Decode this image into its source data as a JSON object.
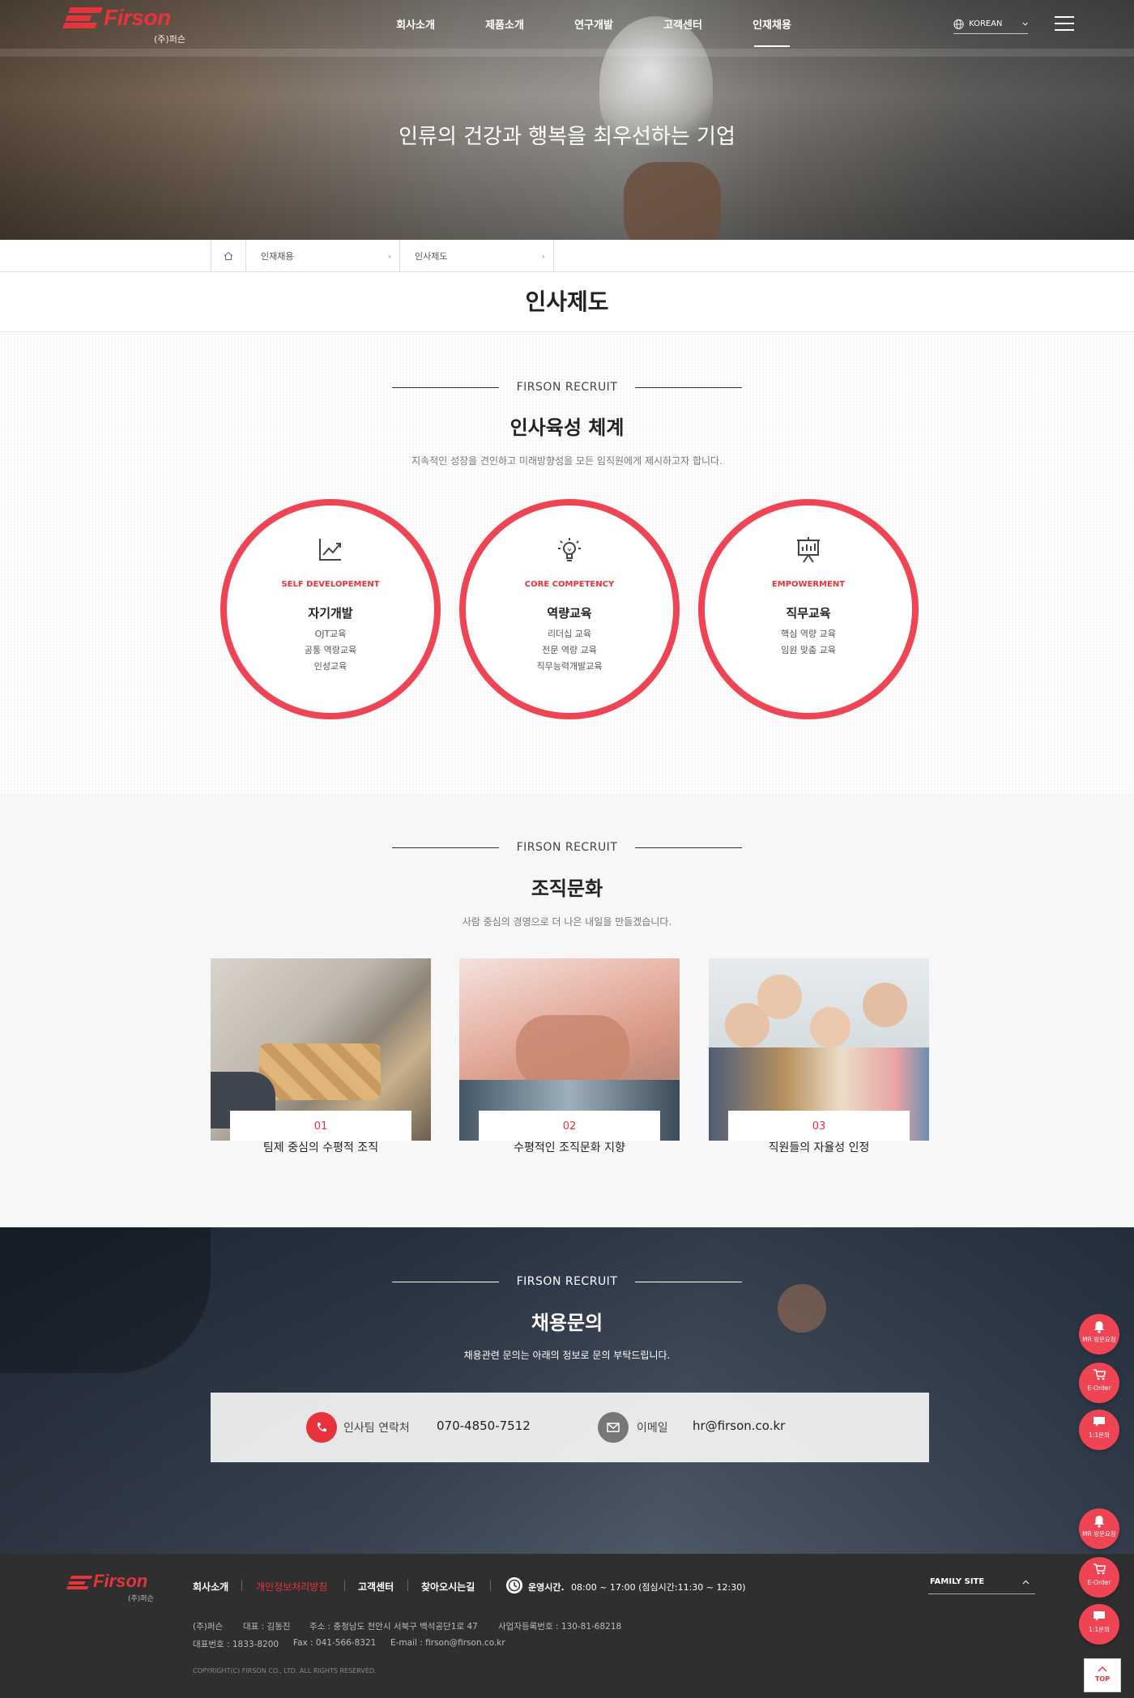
{
  "header": {
    "logo_text": "Firson",
    "logo_sub": "(주)퍼슨",
    "nav": [
      "회사소개",
      "제품소개",
      "연구개발",
      "고객센터",
      "인재채용"
    ],
    "active_nav": "인재채용",
    "language": "KOREAN",
    "hero_title": "인류의 건강과 행복을 최우선하는 기업"
  },
  "breadcrumb": {
    "items": [
      "인재채용",
      "인사제도"
    ]
  },
  "page_title": "인사제도",
  "section_training": {
    "eyebrow": "FIRSON RECRUIT",
    "title": "인사육성 체계",
    "desc": "지속적인 성장을 견인하고 미래방향성을 모든 임직원에게 제시하고자 합니다.",
    "circles": [
      {
        "icon": "growth-chart-icon",
        "en": "SELF DEVELOPEMENT",
        "ko": "자기개발",
        "items": [
          "OJT교육",
          "공통 역량교육",
          "인성교육"
        ]
      },
      {
        "icon": "lightbulb-icon",
        "en": "CORE COMPETENCY",
        "ko": "역량교육",
        "items": [
          "리더십 교육",
          "전문 역량 교육",
          "직무능력개발교육"
        ]
      },
      {
        "icon": "presentation-board-icon",
        "en": "EMPOWERMENT",
        "ko": "직무교육",
        "items": [
          "핵심 역량 교육",
          "임원 맞춤 교육"
        ]
      }
    ],
    "accent_color": "#ef4454"
  },
  "section_culture": {
    "eyebrow": "FIRSON RECRUIT",
    "title": "조직문화",
    "desc": "사람 중심의 경영으로 더 나은 내일을 만들겠습니다.",
    "cards": [
      {
        "num": "01",
        "text": "팀제 중심의 수평적 조직",
        "image": "puzzle-pieces-photo"
      },
      {
        "num": "02",
        "text": "수평적인 조직문화 지향",
        "image": "stacked-hands-photo"
      },
      {
        "num": "03",
        "text": "직원들의 자율성 인정",
        "image": "cheering-team-photo"
      }
    ]
  },
  "section_contact": {
    "eyebrow": "FIRSON RECRUIT",
    "title": "채용문의",
    "desc": "채용관련 문의는 아래의 정보로 문의 부탁드립니다.",
    "phone_label": "인사팀 연락처",
    "phone": "070-4850-7512",
    "email_label": "이메일",
    "email": "hr@firson.co.kr"
  },
  "footer": {
    "logo_text": "Firson",
    "logo_sub": "(주)퍼슨",
    "nav": [
      "회사소개",
      "개인정보처리방침",
      "고객센터",
      "찾아오시는길"
    ],
    "hours_label": "운영시간.",
    "hours": "08:00 ~ 17:00 (점심시간:11:30 ~ 12:30)",
    "family_site": "FAMILY SITE",
    "info_line1": [
      "(주)퍼슨",
      "대표 : 김동진",
      "주소 : 충청남도 천안시 서북구 백석공단1로 47",
      "사업자등록번호 : 130-81-68218"
    ],
    "info_line2": [
      "대표번호 : 1833-8200",
      "Fax : 041-566-8321",
      "E-mail : firson@firson.co.kr"
    ],
    "copyright": "COPYRIGHT(C) FIRSON CO., LTD. ALL RIGHTS RESERVED."
  },
  "floating": {
    "mr": "MR 방문요청",
    "eorder": "E-Order",
    "chat": "1:1문의",
    "top": "TOP"
  }
}
